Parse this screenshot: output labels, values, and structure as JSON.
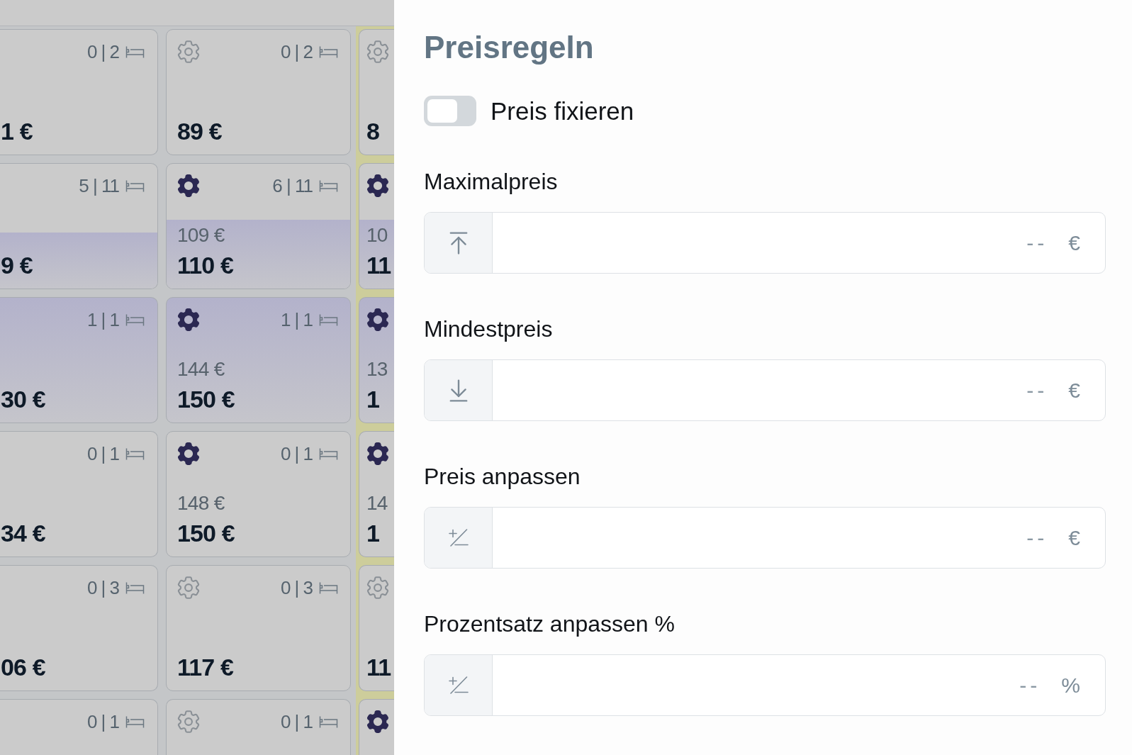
{
  "calendar": {
    "columns": [
      {
        "highlighted": false,
        "cells": [
          {
            "occupancy": "0 | 2",
            "price": "1 €",
            "selected": false,
            "prices_highlighted": false
          },
          {
            "occupancy": "5 | 11",
            "price": "9 €",
            "selected": false,
            "prices_highlighted": true
          },
          {
            "occupancy": "1 | 1",
            "price": "30 €",
            "selected": true,
            "prices_highlighted": false
          },
          {
            "occupancy": "0 | 1",
            "price": "34 €",
            "selected": false,
            "prices_highlighted": false
          },
          {
            "occupancy": "0 | 3",
            "price": "06 €",
            "selected": false,
            "prices_highlighted": false
          },
          {
            "occupancy": "0 | 1",
            "selected": false
          }
        ]
      },
      {
        "highlighted": false,
        "cells": [
          {
            "rule_active": false,
            "occupancy": "0 | 2",
            "price": "89 €",
            "selected": false,
            "prices_highlighted": false
          },
          {
            "rule_active": true,
            "occupancy": "6 | 11",
            "suggested_price": "109 €",
            "price": "110 €",
            "selected": false,
            "prices_highlighted": true
          },
          {
            "rule_active": true,
            "occupancy": "1 | 1",
            "suggested_price": "144 €",
            "price": "150 €",
            "selected": true,
            "prices_highlighted": false
          },
          {
            "rule_active": true,
            "occupancy": "0 | 1",
            "suggested_price": "148 €",
            "price": "150 €",
            "selected": false,
            "prices_highlighted": false
          },
          {
            "rule_active": false,
            "occupancy": "0 | 3",
            "price": "117 €",
            "selected": false,
            "prices_highlighted": false
          },
          {
            "rule_active": false,
            "occupancy": "0 | 1",
            "selected": false
          }
        ]
      },
      {
        "highlighted": true,
        "cells": [
          {
            "rule_active": false,
            "price": "8",
            "selected": false,
            "prices_highlighted": false
          },
          {
            "rule_active": true,
            "suggested_price": "10",
            "price": "11",
            "selected": false,
            "prices_highlighted": true
          },
          {
            "rule_active": true,
            "suggested_price": "13",
            "price": "1",
            "selected": true,
            "prices_highlighted": false
          },
          {
            "rule_active": true,
            "suggested_price": "14",
            "price": "1",
            "selected": false,
            "prices_highlighted": false
          },
          {
            "rule_active": false,
            "price": "11",
            "selected": false,
            "prices_highlighted": false
          },
          {
            "rule_active": true,
            "selected": false
          }
        ]
      }
    ]
  },
  "panel": {
    "title": "Preisregeln",
    "fix_price": {
      "label": "Preis fixieren",
      "on": false
    },
    "fields": [
      {
        "label": "Maximalpreis",
        "kind": "maximum",
        "placeholder": "--",
        "unit": "€"
      },
      {
        "label": "Mindestpreis",
        "kind": "minimum",
        "placeholder": "--",
        "unit": "€"
      },
      {
        "label": "Preis anpassen",
        "kind": "adjustment",
        "placeholder": "--",
        "unit": "€"
      },
      {
        "label": "Prozentsatz anpassen %",
        "kind": "adjustment",
        "placeholder": "--",
        "unit": "%"
      }
    ]
  }
}
